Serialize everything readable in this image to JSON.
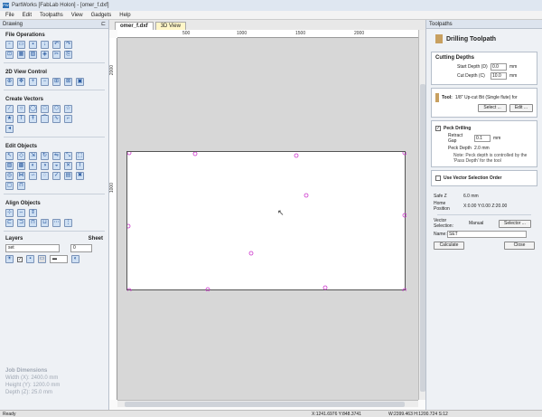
{
  "window": {
    "title": "PartWorks [FabLab Holon] - [omer_f.dxf]",
    "app_icon": "PW"
  },
  "menu": [
    "File",
    "Edit",
    "Toolpaths",
    "View",
    "Gadgets",
    "Help"
  ],
  "left_panel": {
    "header": "Drawing",
    "pin": "⊏",
    "sections": {
      "file_ops": "File Operations",
      "view_ctrl": "2D View Control",
      "create_vectors": "Create Vectors",
      "edit_objects": "Edit Objects",
      "align_objects": "Align Objects"
    },
    "layers": {
      "label": "Layers",
      "value": "set",
      "sheet_label": "Sheet",
      "sheet_value": "0"
    },
    "job_dimensions": {
      "title": "Job Dimensions",
      "width": "Width  (X): 2400.0 mm",
      "height": "Height (Y): 1200.0 mm",
      "depth": "Depth  (Z): 25.0 mm"
    }
  },
  "tabs": [
    {
      "label": "omer_f.dxf"
    },
    {
      "label": "3D View"
    }
  ],
  "rulers": {
    "top": [
      "500",
      "1000",
      "1500",
      "2000"
    ],
    "left": [
      "2000",
      "1000"
    ]
  },
  "right_panel": {
    "header": "Toolpaths",
    "title": "Drilling Toolpath",
    "cutting_depths": {
      "title": "Cutting Depths",
      "start_label": "Start Depth (D)",
      "start_value": "0.0",
      "start_unit": "mm",
      "cut_label": "Cut Depth (C)",
      "cut_value": "10.0",
      "cut_unit": "mm"
    },
    "tool": {
      "label": "Tool:",
      "value": "1/8\" Up-cut Bit (Single flute) for",
      "select_btn": "Select ...",
      "edit_btn": "Edit ..."
    },
    "peck": {
      "label": "Peck Drilling",
      "retract_label": "Retract Gap",
      "retract_value": "0.1",
      "retract_unit": "mm",
      "peck_label": "Peck Depth",
      "peck_value": "2.0 mm",
      "note1": "Note: Peck depth is controlled by the",
      "note2": "'Pass Depth' for the tool"
    },
    "vector_order": {
      "label": "Use Vector Selection Order"
    },
    "safe_z": {
      "label": "Safe Z",
      "value": "6.0 mm"
    },
    "home": {
      "label": "Home Position",
      "value": "X:0.00 Y:0.00 Z:20.00"
    },
    "vector_selection": {
      "label": "Vector Selection:",
      "value": "Manual",
      "btn": "Selector ..."
    },
    "name": {
      "label": "Name:",
      "value": "SET"
    },
    "calculate_btn": "Calculate",
    "close_btn": "Close"
  },
  "status": {
    "ready": "Ready",
    "coords": "X:1241.6976 Y:848.3741",
    "size": "W:2399.463  H:1200.724  S:12"
  },
  "colors": {
    "drill_marker": "#cc33cc",
    "accent": "#2a6fb5"
  }
}
